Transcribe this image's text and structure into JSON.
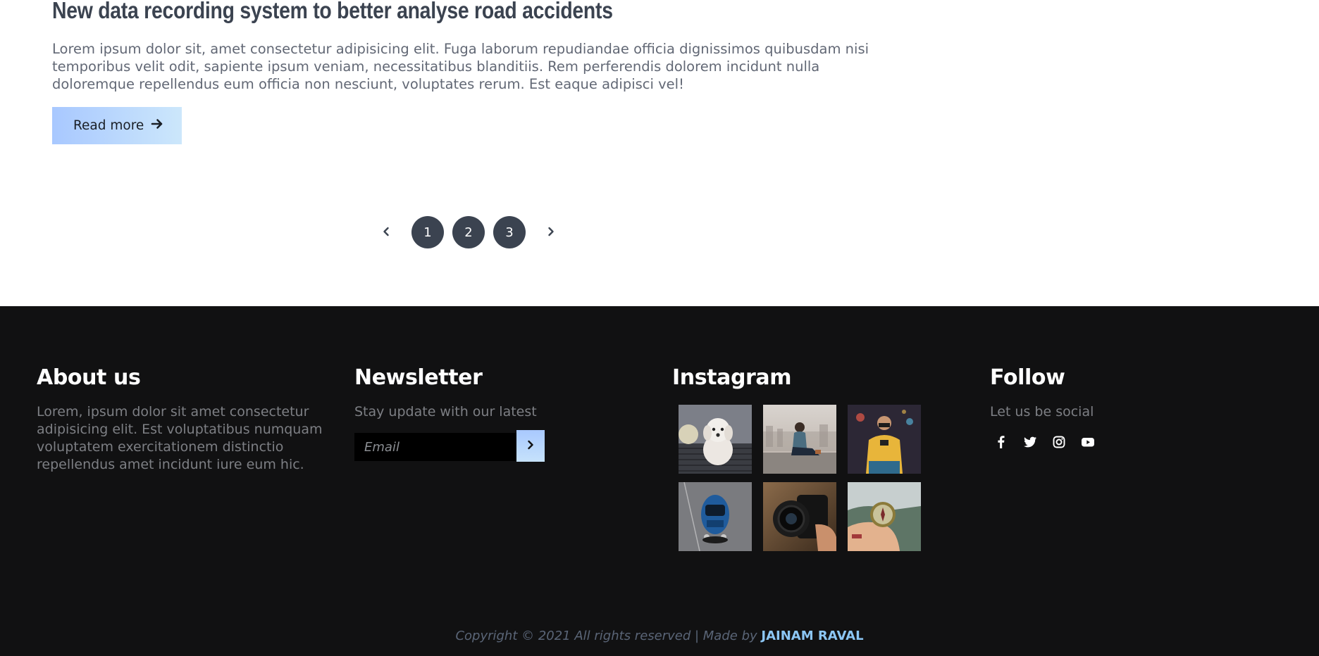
{
  "article": {
    "title": "New data recording system to better analyse road accidents",
    "excerpt": "Lorem ipsum dolor sit, amet consectetur adipisicing elit. Fuga laborum repudiandae officia dignissimos quibusdam nisi temporibus velit odit, sapiente ipsum veniam, necessitatibus blanditiis. Rem perferendis dolorem incidunt nulla doloremque repellendus eum officia non nesciunt, voluptates rerum. Est eaque adipisci vel!",
    "read_more_label": "Read more",
    "read_more_icon": "arrow-right-icon"
  },
  "pagination": {
    "prev_icon": "chevron-left-icon",
    "next_icon": "chevron-right-icon",
    "pages": [
      "1",
      "2",
      "3"
    ]
  },
  "footer": {
    "about": {
      "heading": "About us",
      "text": "Lorem, ipsum dolor sit amet consectetur adipisicing elit. Est voluptatibus numquam voluptatem exercitationem distinctio repellendus amet incidunt iure eum hic."
    },
    "newsletter": {
      "heading": "Newsletter",
      "text": "Stay update with our latest",
      "email_placeholder": "Email",
      "email_value": "",
      "submit_icon": "chevron-right-icon"
    },
    "instagram": {
      "heading": "Instagram",
      "photos": [
        "dog-photo",
        "woman-on-rooftop-photo",
        "man-in-yellow-sweater-photo",
        "blue-car-photo",
        "camera-lens-photo",
        "compass-in-hand-photo"
      ]
    },
    "follow": {
      "heading": "Follow",
      "text": "Let us be social",
      "icons": [
        "facebook-icon",
        "twitter-icon",
        "instagram-icon",
        "youtube-icon"
      ]
    },
    "copyright": {
      "text": "Copyright © 2021 All rights reserved | Made by ",
      "author": "JAINAM RAVAL"
    }
  },
  "colors": {
    "heading_dark": "#3b4350",
    "body_text": "#626875",
    "accent_gradient_start": "#a8c8ff",
    "accent_gradient_end": "#cce7fb",
    "footer_bg": "#111112",
    "footer_muted_text": "#7d7f84",
    "author_link": "#8cc6f4"
  }
}
